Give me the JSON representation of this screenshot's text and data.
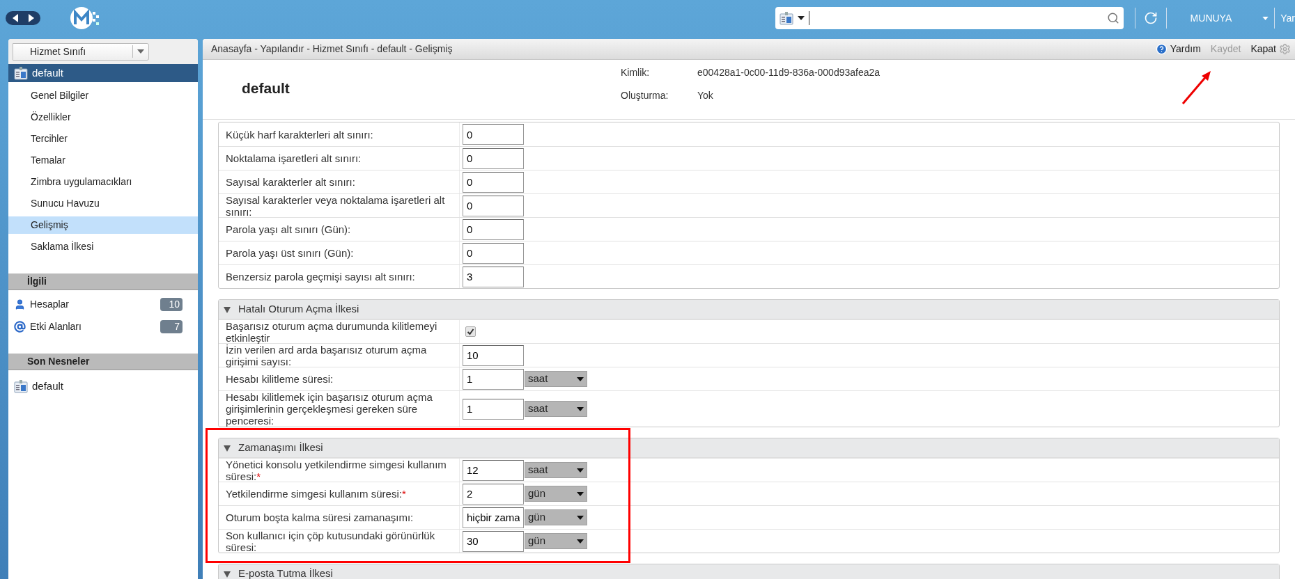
{
  "top_bar": {
    "user": "MUNUYA",
    "cut_menu": "Yar"
  },
  "sidebar": {
    "object_type": "Hizmet Sınıfı",
    "current": "default",
    "items": [
      {
        "label": "Genel Bilgiler",
        "selected": false
      },
      {
        "label": "Özellikler",
        "selected": false
      },
      {
        "label": "Tercihler",
        "selected": false
      },
      {
        "label": "Temalar",
        "selected": false
      },
      {
        "label": "Zimbra uygulamacıkları",
        "selected": false
      },
      {
        "label": "Sunucu Havuzu",
        "selected": false
      },
      {
        "label": "Gelişmiş",
        "selected": true
      },
      {
        "label": "Saklama İlkesi",
        "selected": false
      }
    ],
    "related": {
      "title": "İlgili",
      "items": [
        {
          "kind": "account",
          "label": "Hesaplar",
          "count": "10"
        },
        {
          "kind": "domain",
          "label": "Etki Alanları",
          "count": "7"
        }
      ]
    },
    "recent": {
      "title": "Son Nesneler",
      "items": [
        {
          "label": "default"
        }
      ]
    }
  },
  "header": {
    "breadcrumb": "Anasayfa - Yapılandır - Hizmet Sınıfı - default - Gelişmiş",
    "actions": [
      {
        "kind": "help",
        "label": "Yardım",
        "disabled": false
      },
      {
        "kind": "save",
        "label": "Kaydet",
        "disabled": true
      },
      {
        "kind": "close",
        "label": "Kapat",
        "disabled": false
      }
    ]
  },
  "title": "default",
  "info": [
    {
      "label": "Kimlik:",
      "value": "e00428a1-0c00-11d9-836a-000d93afea2a"
    },
    {
      "label": "Oluşturma:",
      "value": "Yok"
    }
  ],
  "sections": [
    {
      "rows": [
        {
          "kind": "number",
          "label": "Küçük harf karakterleri alt sınırı:",
          "value": "0"
        },
        {
          "kind": "number",
          "label": "Noktalama işaretleri alt sınırı:",
          "value": "0"
        },
        {
          "kind": "number",
          "label": "Sayısal karakterler alt sınırı:",
          "value": "0"
        },
        {
          "kind": "number",
          "label": "Sayısal karakterler veya noktalama işaretleri alt sınırı:",
          "value": "0"
        },
        {
          "kind": "number",
          "label": "Parola yaşı alt sınırı (Gün):",
          "value": "0"
        },
        {
          "kind": "number",
          "label": "Parola yaşı üst sınırı (Gün):",
          "value": "0"
        },
        {
          "kind": "number",
          "label": "Benzersiz parola geçmişi sayısı alt sınırı:",
          "value": "3"
        }
      ]
    },
    {
      "title": "Hatalı Oturum Açma İlkesi",
      "expanded": true,
      "rows": [
        {
          "kind": "checkbox",
          "label": "Başarısız oturum açma durumunda kilitlemeyi etkinleştir",
          "checked": true
        },
        {
          "kind": "number",
          "label": "İzin verilen ard arda başarısız oturum açma girişimi sayısı:",
          "value": "10"
        },
        {
          "kind": "number_unit",
          "label": "Hesabı kilitleme süresi:",
          "value": "1",
          "unit": "saat"
        },
        {
          "kind": "number_unit",
          "label": "Hesabı kilitlemek için başarısız oturum açma girişimlerinin gerçekleşmesi gereken süre penceresi:",
          "value": "1",
          "unit": "saat"
        }
      ]
    },
    {
      "title": "Zamanaşımı İlkesi",
      "expanded": true,
      "highlighted": true,
      "rows": [
        {
          "kind": "number_unit",
          "label": "Yönetici konsolu yetkilendirme simgesi kullanım süresi:",
          "required_mark": "*",
          "value": "12",
          "unit": "saat"
        },
        {
          "kind": "number_unit",
          "label": "Yetkilendirme simgesi kullanım süresi:",
          "required_mark": "*",
          "value": "2",
          "unit": "gün"
        },
        {
          "kind": "number_unit",
          "label": "Oturum boşta kalma süresi zamanaşımı:",
          "value": "hiçbir zama",
          "unit": "gün"
        },
        {
          "kind": "number_unit",
          "label": "Son kullanıcı için çöp kutusundaki görünürlük süresi:",
          "value": "30",
          "unit": "gün"
        }
      ]
    },
    {
      "title": "E-posta Tutma İlkesi",
      "expanded": true
    }
  ]
}
